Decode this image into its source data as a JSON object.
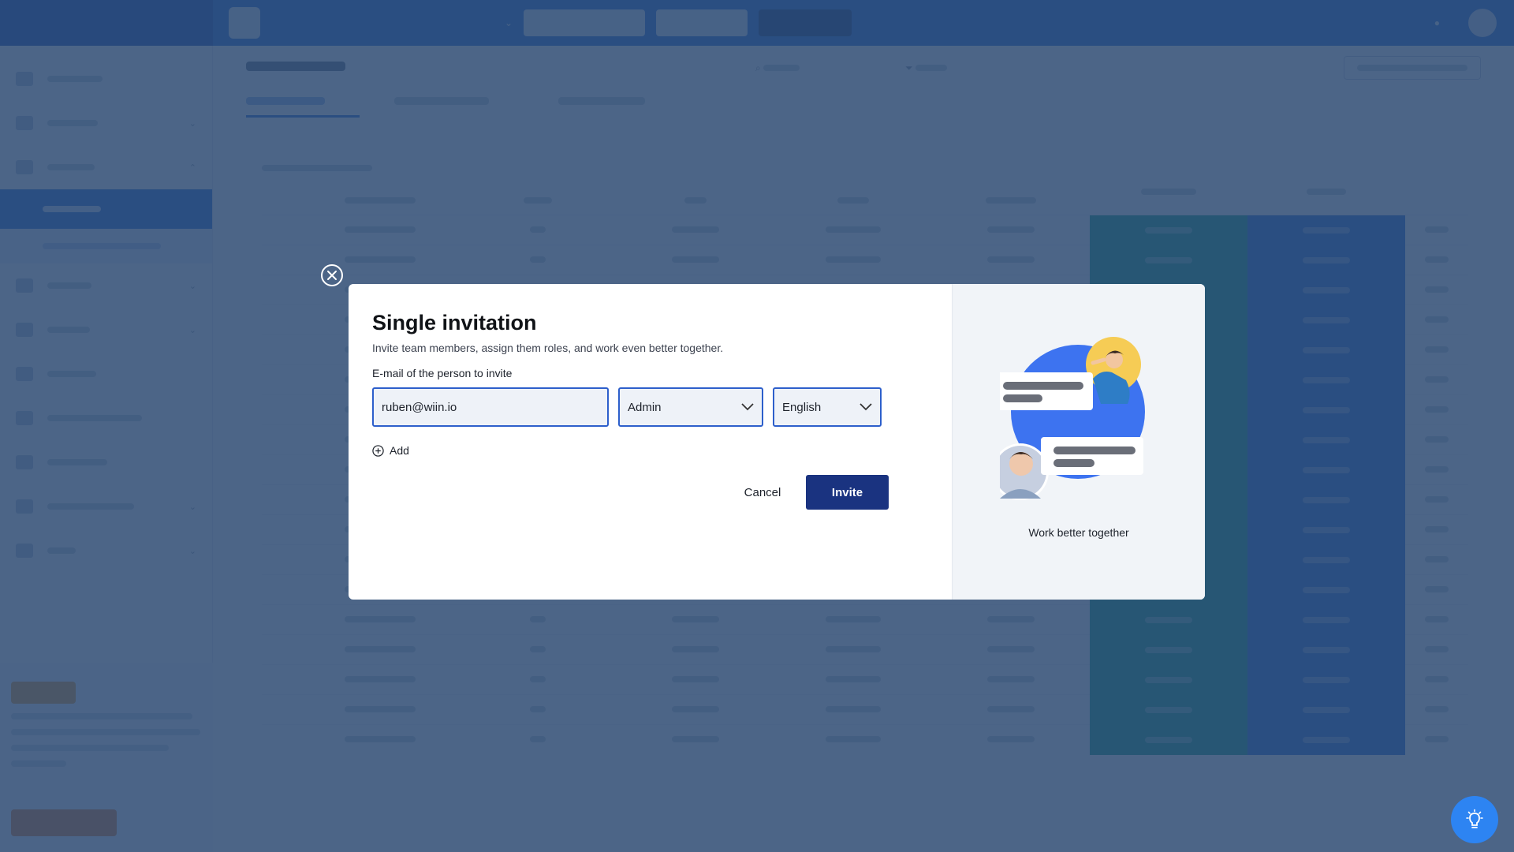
{
  "background": {
    "brand": "",
    "org": {
      "name": "",
      "sub": ""
    },
    "toolbar_buttons": [
      "",
      "",
      ""
    ],
    "user_label": "",
    "sidebar_items": [
      "",
      "",
      "",
      "",
      "",
      "",
      "",
      "",
      "",
      ""
    ],
    "page_title": "",
    "search_placeholder": "",
    "filter_label": "",
    "tabs": [
      "",
      "",
      ""
    ],
    "rows": 18
  },
  "modal": {
    "title": "Single invitation",
    "subtitle": "Invite team members, assign them roles, and work even better together.",
    "email_label": "E-mail of the person to invite",
    "email_value": "ruben@wiin.io",
    "role_value": "Admin",
    "language_value": "English",
    "add_label": "Add",
    "cancel_label": "Cancel",
    "invite_label": "Invite",
    "illustration_caption": "Work better together"
  },
  "icons": {
    "close": "close-icon",
    "chevron": "chevron-down-icon",
    "add": "plus-circle-icon",
    "help": "lightbulb-icon"
  },
  "colors": {
    "primary_blue": "#2f6fd8",
    "invite_button": "#1a3380",
    "field_border": "#2d5fcb",
    "overlay": "#2a4870",
    "fab": "#2d84f2",
    "teal_column": "#19a38a"
  }
}
